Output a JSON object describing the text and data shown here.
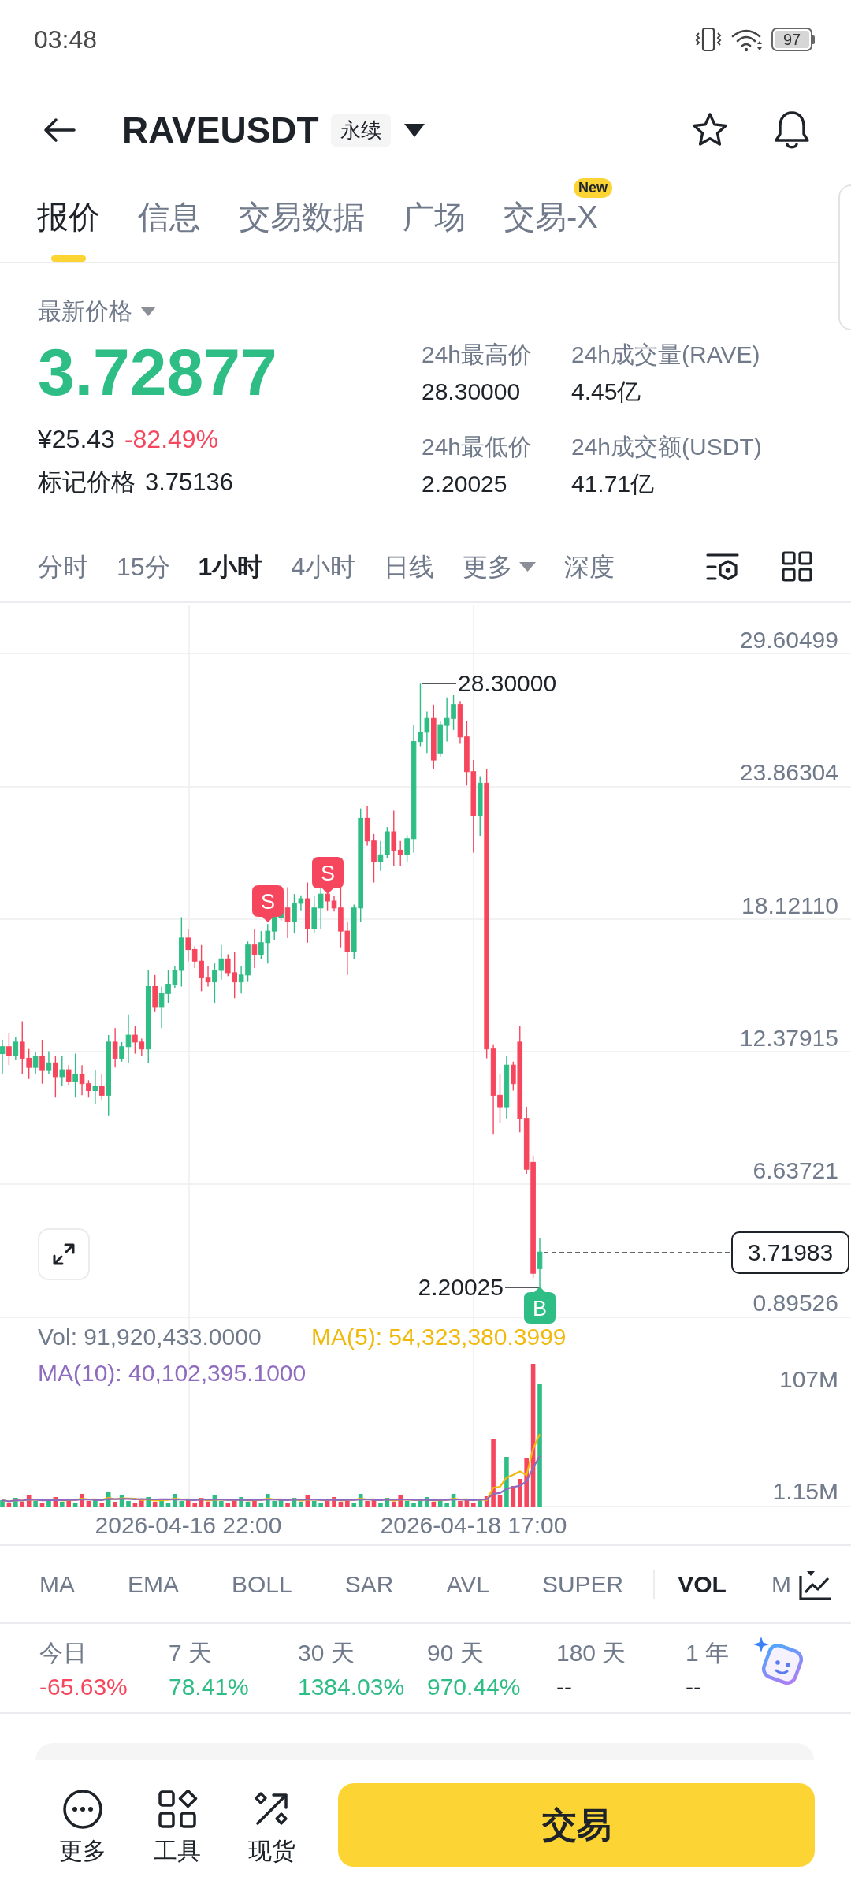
{
  "status_bar": {
    "time": "03:48",
    "battery": "97"
  },
  "header": {
    "symbol": "RAVEUSDT",
    "contract_tag": "永续"
  },
  "tabs": [
    {
      "label": "报价",
      "selected": true
    },
    {
      "label": "信息",
      "selected": false
    },
    {
      "label": "交易数据",
      "selected": false
    },
    {
      "label": "广场",
      "selected": false
    },
    {
      "label": "交易-X",
      "selected": false,
      "badge": "New"
    }
  ],
  "price_panel": {
    "label": "最新价格",
    "last_price": {
      "value": "3.72877",
      "color": "#2ebd85"
    },
    "fiat_price": "¥25.43",
    "change": {
      "value": "-82.49%",
      "color": "#f6465d"
    },
    "mark_label": "标记价格",
    "mark_price": "3.75136",
    "stats": [
      {
        "label": "24h最高价",
        "value": "28.30000"
      },
      {
        "label": "24h成交量(RAVE)",
        "value": "4.45亿"
      },
      {
        "label": "24h最低价",
        "value": "2.20025"
      },
      {
        "label": "24h成交额(USDT)",
        "value": "41.71亿"
      }
    ]
  },
  "intervals": [
    {
      "label": "分时",
      "kind": "option",
      "selected": false
    },
    {
      "label": "15分",
      "kind": "option",
      "selected": false
    },
    {
      "label": "1小时",
      "kind": "option",
      "selected": true
    },
    {
      "label": "4小时",
      "kind": "option",
      "selected": false
    },
    {
      "label": "日线",
      "kind": "option",
      "selected": false
    },
    {
      "label": "更多",
      "kind": "dropdown",
      "selected": false
    },
    {
      "label": "深度",
      "kind": "option",
      "selected": false
    }
  ],
  "chart": {
    "price_axis": [
      "29.60499",
      "23.86304",
      "18.12110",
      "12.37915",
      "6.63721",
      "0.89526"
    ],
    "high_label": "28.30000",
    "low_label": "2.20025",
    "current_price": "3.71983",
    "markers": [
      {
        "kind": "sell",
        "label": "S"
      },
      {
        "kind": "sell",
        "label": "S"
      },
      {
        "kind": "buy",
        "label": "B"
      }
    ],
    "volume_legend": [
      {
        "kind": "vol",
        "text": "Vol: 91,920,433.0000",
        "color": "#707a8a"
      },
      {
        "kind": "ma5",
        "text": "MA(5): 54,323,380.3999",
        "color": "#f0b90b"
      },
      {
        "kind": "ma10",
        "text": "MA(10): 40,102,395.1000",
        "color": "#8e6bbf"
      }
    ],
    "volume_axis": [
      "107M",
      "1.15M"
    ],
    "time_axis": [
      "2026-04-16 22:00",
      "2026-04-18 17:00"
    ]
  },
  "indicators": {
    "main": [
      {
        "label": "MA",
        "selected": false
      },
      {
        "label": "EMA",
        "selected": false
      },
      {
        "label": "BOLL",
        "selected": false
      },
      {
        "label": "SAR",
        "selected": false
      },
      {
        "label": "AVL",
        "selected": false
      },
      {
        "label": "SUPER",
        "selected": false
      }
    ],
    "sub": [
      {
        "label": "VOL",
        "selected": true
      },
      {
        "label": "M",
        "selected": false
      }
    ]
  },
  "periods": [
    {
      "label": "今日",
      "value": "-65.63%",
      "color": "#f6465d"
    },
    {
      "label": "7 天",
      "value": "78.41%",
      "color": "#2ebd85"
    },
    {
      "label": "30 天",
      "value": "1384.03%",
      "color": "#2ebd85"
    },
    {
      "label": "90 天",
      "value": "970.44%",
      "color": "#2ebd85"
    },
    {
      "label": "180 天",
      "value": "--",
      "color": "#1e2329"
    },
    {
      "label": "1 年",
      "value": "--",
      "color": "#1e2329"
    }
  ],
  "bottom_bar": {
    "actions": [
      {
        "kind": "more",
        "label": "更多"
      },
      {
        "kind": "tools",
        "label": "工具"
      },
      {
        "kind": "spot",
        "label": "现货"
      }
    ],
    "trade_button": "交易"
  }
}
